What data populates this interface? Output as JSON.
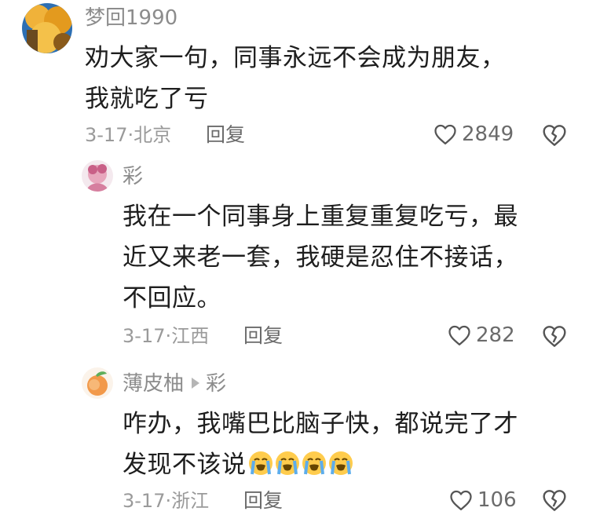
{
  "comments": [
    {
      "username": "梦回1990",
      "text_line1": "劝大家一句，同事永远不会成为朋友，",
      "text_line2": "我就吃了亏",
      "date": "3-17",
      "location": "北京",
      "reply_label": "回复",
      "likes": "2849"
    },
    {
      "username": "彩",
      "text_line1": "我在一个同事身上重复重复吃亏，最",
      "text_line2": "近又来老一套，我硬是忍住不接话，",
      "text_line3": "不回应。",
      "date": "3-17",
      "location": "江西",
      "reply_label": "回复",
      "likes": "282"
    },
    {
      "username": "薄皮柚",
      "reply_to": "彩",
      "text_line1": "咋办，我嘴巴比脑子快，都说完了才",
      "text_line2": "发现不该说",
      "date": "3-17",
      "location": "浙江",
      "reply_label": "回复",
      "likes": "106"
    }
  ],
  "icons": {
    "like": "heart-outline-icon",
    "dislike": "broken-heart-icon",
    "emoji": "loudly-crying-face-emoji"
  },
  "colors": {
    "username": "#8c8c8c",
    "meta": "#9a9a9a",
    "text": "#1e1e1e"
  }
}
